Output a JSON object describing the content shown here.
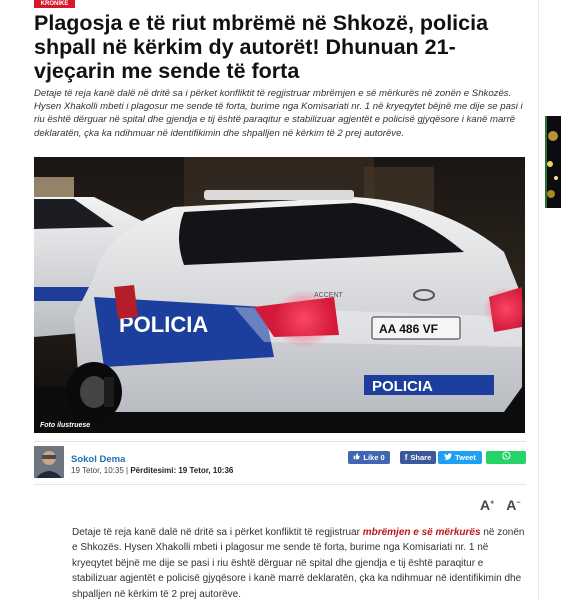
{
  "category": "KRONIKE",
  "article": {
    "title": "Plagosja e të riut mbrëmë në Shkozë, policia shpall në kërkim dy autorët! Dhunuan 21-vjeçarin me sende të forta",
    "lead": "Detaje të reja kanë dalë në dritë sa i përket konfliktit të regjistruar mbrëmjen e së mërkurës në zonën e Shkozës. Hysen Xhakolli mbeti i plagosur me sende të forta, burime nga Komisariati nr. 1 në kryeqytet bëjnë me dije se pasi i riu është dërguar në spital dhe gjendja e tij është paraqitur e stabilizuar  agjentët e policisë gjyqësore i kanë marrë deklaratën, çka ka ndihmuar në identifikimin dhe shpalljen në kërkim të 2 prej autorëve.",
    "image_caption": "Foto ilustruese",
    "author": "Sokol Dema",
    "date": "19 Tetor, 10:35",
    "separator": " | ",
    "updated_label": "Përditesimi: 19 Tetor, 10:36",
    "body_part1": "Detaje të reja kanë dalë në dritë sa i përket konfliktit të regjistruar ",
    "body_link": "mbrëmjen e së mërkurës",
    "body_part2": " në zonën e Shkozës. Hysen Xhakolli mbeti i plagosur me sende të forta, burime nga Komisariati nr. 1 në kryeqytet bëjnë me dije se pasi i riu është dërguar në spital dhe gjendja e tij është paraqitur e stabilizuar  agjentët e policisë gjyqësore i kanë marrë deklaratën, çka ka ndihmuar në identifikimin dhe shpalljen në kërkim të 2 prej autorëve."
  },
  "share": {
    "like": "Like 0",
    "facebook": "Share",
    "twitter": "Tweet",
    "whatsapp_icon": "whatsapp-icon"
  },
  "font_tools": {
    "increase": "A",
    "decrease": "A"
  },
  "photo_text": {
    "police_side": "POLICIA",
    "police_rear": "POLICIA",
    "plate": "AA 486 VF",
    "model": "ACCENT"
  },
  "colors": {
    "accent_red": "#d7182a",
    "link_blue": "#1d6fb8",
    "facebook": "#3b5998",
    "twitter": "#1da1f2",
    "whatsapp": "#25d366"
  }
}
